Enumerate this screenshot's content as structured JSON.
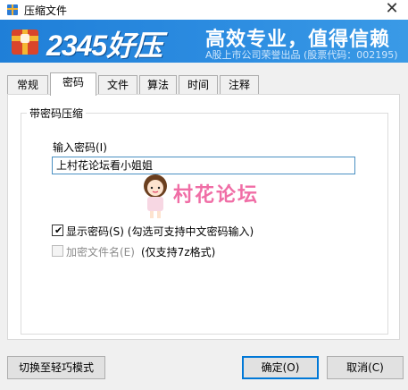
{
  "window": {
    "title": "压缩文件",
    "close_label": "✕"
  },
  "banner": {
    "logo_text": "2345好压",
    "slogan": "高效专业，值得信赖",
    "subtitle": "A股上市公司荣誉出品 (股票代码：002195)"
  },
  "tabs": [
    {
      "label": "常规"
    },
    {
      "label": "密码"
    },
    {
      "label": "文件"
    },
    {
      "label": "算法"
    },
    {
      "label": "时间"
    },
    {
      "label": "注释"
    }
  ],
  "group": {
    "legend": "带密码压缩",
    "password_label": "输入密码(I)",
    "password_value": "上村花论坛看小姐姐",
    "show_password": {
      "label": "显示密码(S) (勾选可支持中文密码输入)",
      "checked": true
    },
    "encrypt_filenames": {
      "label": "加密文件名(E)",
      "note": "(仅支持7z格式)",
      "checked": false
    }
  },
  "watermark": {
    "text": "村花论坛"
  },
  "buttons": {
    "switch_mode": "切换至轻巧模式",
    "ok": "确定(O)",
    "cancel": "取消(C)"
  }
}
